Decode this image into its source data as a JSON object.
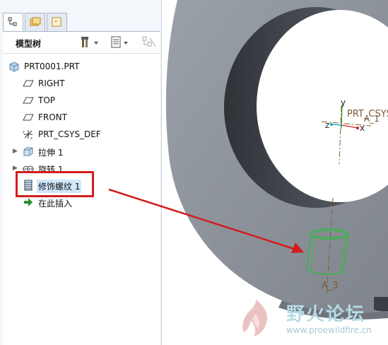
{
  "model_tree": {
    "tabs": [
      {
        "name": "model-tree-tab",
        "icon": "tree-icon"
      },
      {
        "name": "folder-tab",
        "icon": "folder-icon"
      },
      {
        "name": "favorites-tab",
        "icon": "star-icon"
      }
    ],
    "title": "模型树",
    "items": [
      {
        "label": "PRT0001.PRT",
        "icon": "part-icon"
      },
      {
        "label": "RIGHT",
        "icon": "datum-plane-icon"
      },
      {
        "label": "TOP",
        "icon": "datum-plane-icon"
      },
      {
        "label": "FRONT",
        "icon": "datum-plane-icon"
      },
      {
        "label": "PRT_CSYS_DEF",
        "icon": "csys-icon"
      },
      {
        "label": "拉伸 1",
        "icon": "extrude-icon",
        "expandable": true
      },
      {
        "label": "旋转 1",
        "icon": "revolve-icon",
        "expandable": true
      },
      {
        "label": "修饰螺纹 1",
        "icon": "cosmetic-thread-icon",
        "selected": true
      },
      {
        "label": "在此插入",
        "icon": "insert-here-arrow-icon"
      }
    ]
  },
  "viewport": {
    "csys_label": "PRT_CSYS",
    "axis_labels": {
      "x": "x",
      "y": "y",
      "z": "z"
    },
    "axis1_label": "A_1",
    "axis3_label": "A_3"
  },
  "watermark": {
    "title": "野火论坛",
    "url": "www.proewildfire.cn"
  },
  "colors": {
    "highlight_box": "#d31d1d",
    "annotation_arrow": "#d31d1d",
    "thread_feature": "#2dbb3d",
    "part_body": "#8d9199"
  }
}
